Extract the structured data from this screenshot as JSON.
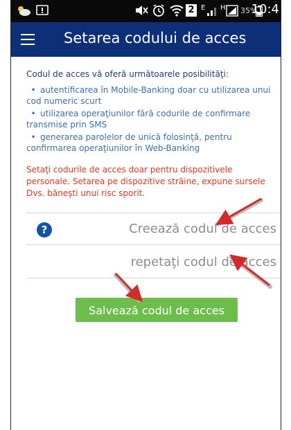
{
  "status_bar": {
    "time": "10:4",
    "battery_percent": "35%",
    "sim_indicator": "2",
    "network_e": "E",
    "network_h": "H",
    "icons": [
      "weather-icon",
      "notification-icon",
      "mute-icon",
      "alarm-icon",
      "wifi-icon",
      "sim-2-icon",
      "signal-icon",
      "battery-icon"
    ]
  },
  "app_bar": {
    "title": "Setarea codului de acces",
    "color": "#0c2f77",
    "menu_icon": "hamburger-icon"
  },
  "content": {
    "intro": "Codul de acces vă oferă următoarele posibilităţi:",
    "bullets": [
      "autentificarea în Mobile-Banking doar cu utilizarea unui cod numeric scurt",
      "utilizarea operaţiunilor fără codurile de confirmare transmise prin SMS",
      "generarea parolelor de unică folosinţă, pentru confirmarea operaţiunilor în Web-Banking"
    ],
    "warning": "Setaţi codurile de acces doar pentru dispozitivele personale. Setarea pe dispozitive străine, expune sursele Dvs. băneşti unui risc sporit.",
    "warning_color": "#e3371e"
  },
  "form": {
    "help_icon": "question-mark-icon",
    "create_code_placeholder": "Creează codul de acces",
    "repeat_code_placeholder": "repetaţi codul de acces",
    "create_code_value": "",
    "repeat_code_value": "",
    "save_label": "Salvează codul de acces",
    "save_color": "#6cbd4c"
  },
  "annotations": {
    "arrow_color": "#d42a2a",
    "arrow_count": 3
  }
}
